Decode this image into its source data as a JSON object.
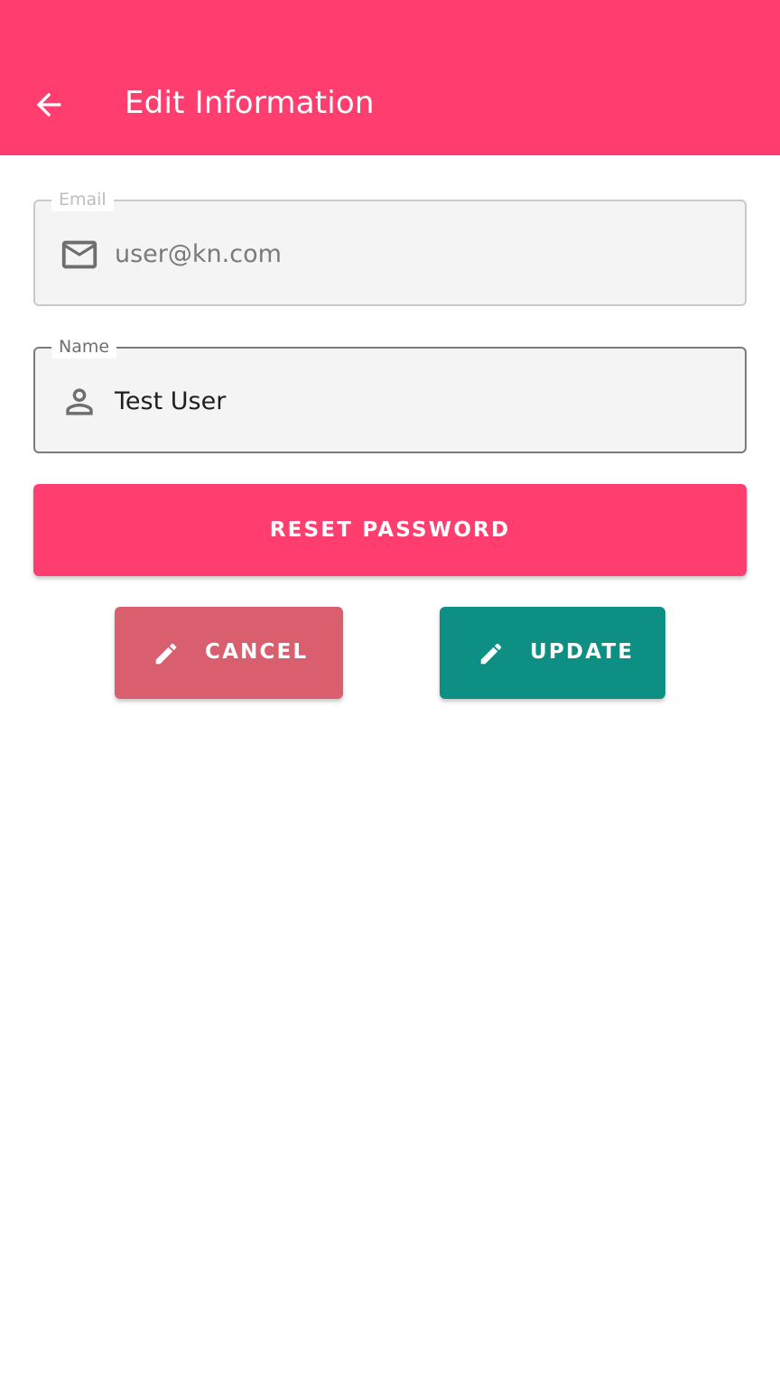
{
  "appbar": {
    "title": "Edit Information",
    "back_icon": "arrow-left-icon",
    "color": "#FF3D6E"
  },
  "form": {
    "email": {
      "label": "Email",
      "value": "user@kn.com",
      "icon": "mail-icon"
    },
    "name": {
      "label": "Name",
      "value": "Test User",
      "icon": "person-icon"
    }
  },
  "buttons": {
    "reset_password": {
      "label": "RESET PASSWORD",
      "color": "#FF3D6E"
    },
    "cancel": {
      "label": "CANCEL",
      "icon": "pencil-icon",
      "color": "#D95F6F"
    },
    "update": {
      "label": "UPDATE",
      "icon": "pencil-icon",
      "color": "#0E8F83"
    }
  }
}
